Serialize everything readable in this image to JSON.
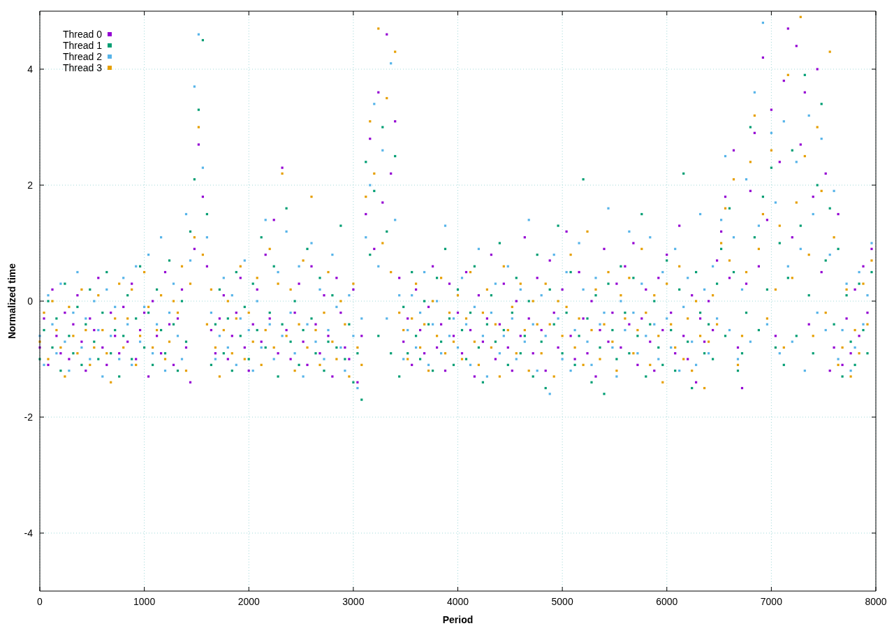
{
  "chart_data": {
    "type": "scatter",
    "xlabel": "Period",
    "ylabel": "Normalized time",
    "xlim": [
      0,
      8000
    ],
    "ylim": [
      -5,
      5
    ],
    "grid": true,
    "legend": true,
    "xticks": [
      {
        "value": 0,
        "label": "0"
      },
      {
        "value": 1000,
        "label": "1000"
      },
      {
        "value": 2000,
        "label": "2000"
      },
      {
        "value": 3000,
        "label": "3000"
      },
      {
        "value": 4000,
        "label": "4000"
      },
      {
        "value": 5000,
        "label": "5000"
      },
      {
        "value": 6000,
        "label": "6000"
      },
      {
        "value": 7000,
        "label": "7000"
      },
      {
        "value": 8000,
        "label": "8000"
      }
    ],
    "yticks": [
      {
        "value": -4,
        "label": "-4"
      },
      {
        "value": -2,
        "label": "-2"
      },
      {
        "value": 0,
        "label": "0"
      },
      {
        "value": 2,
        "label": "2"
      },
      {
        "value": 4,
        "label": "4"
      }
    ],
    "x": [
      0,
      40,
      80,
      120,
      160,
      200,
      240,
      280,
      320,
      360,
      400,
      440,
      480,
      520,
      560,
      600,
      640,
      680,
      720,
      760,
      800,
      840,
      880,
      920,
      960,
      1000,
      1040,
      1080,
      1120,
      1160,
      1200,
      1240,
      1280,
      1320,
      1360,
      1400,
      1440,
      1480,
      1520,
      1560,
      1600,
      1640,
      1680,
      1720,
      1760,
      1800,
      1840,
      1880,
      1920,
      1960,
      2000,
      2040,
      2080,
      2120,
      2160,
      2200,
      2240,
      2280,
      2320,
      2360,
      2400,
      2440,
      2480,
      2520,
      2560,
      2600,
      2640,
      2680,
      2720,
      2760,
      2800,
      2840,
      2880,
      2920,
      2960,
      3000,
      3040,
      3080,
      3120,
      3160,
      3200,
      3240,
      3280,
      3320,
      3360,
      3400,
      3440,
      3480,
      3520,
      3560,
      3600,
      3640,
      3680,
      3720,
      3760,
      3800,
      3840,
      3880,
      3920,
      3960,
      4000,
      4040,
      4080,
      4120,
      4160,
      4200,
      4240,
      4280,
      4320,
      4360,
      4400,
      4440,
      4480,
      4520,
      4560,
      4600,
      4640,
      4680,
      4720,
      4760,
      4800,
      4840,
      4880,
      4920,
      4960,
      5000,
      5040,
      5080,
      5120,
      5160,
      5200,
      5240,
      5280,
      5320,
      5360,
      5400,
      5440,
      5480,
      5520,
      5560,
      5600,
      5640,
      5680,
      5720,
      5760,
      5800,
      5840,
      5880,
      5920,
      5960,
      6000,
      6040,
      6080,
      6120,
      6160,
      6200,
      6240,
      6280,
      6320,
      6360,
      6400,
      6440,
      6480,
      6520,
      6560,
      6600,
      6640,
      6680,
      6720,
      6760,
      6800,
      6840,
      6880,
      6920,
      6960,
      7000,
      7040,
      7080,
      7120,
      7160,
      7200,
      7240,
      7280,
      7320,
      7360,
      7400,
      7440,
      7480,
      7520,
      7560,
      7600,
      7640,
      7680,
      7720,
      7760,
      7800,
      7840,
      7880,
      7920,
      7960
    ],
    "series": [
      {
        "name": "Thread 0",
        "color": "#9400d3",
        "values": [
          -0.8,
          -0.3,
          -1.1,
          0.2,
          -0.6,
          -0.9,
          -0.2,
          -1.0,
          -0.4,
          0.1,
          -0.7,
          -1.2,
          -0.3,
          -0.5,
          0.4,
          -0.8,
          -1.1,
          -0.2,
          -0.6,
          -0.9,
          -0.1,
          -0.7,
          0.3,
          -1.0,
          -0.5,
          -0.2,
          -1.3,
          0.0,
          -0.6,
          -0.9,
          0.5,
          -0.4,
          -1.1,
          -0.3,
          0.2,
          -0.8,
          -1.4,
          0.9,
          2.7,
          1.8,
          0.6,
          -0.5,
          -0.9,
          -0.3,
          0.1,
          -1.0,
          -0.6,
          -0.2,
          0.4,
          -0.8,
          -1.2,
          -0.4,
          0.2,
          -0.7,
          0.8,
          -0.3,
          1.4,
          -0.9,
          2.3,
          -0.5,
          -1.0,
          -0.2,
          0.3,
          -0.7,
          -1.1,
          0.6,
          -0.4,
          -0.9,
          0.1,
          -0.6,
          -1.3,
          0.4,
          -0.2,
          -0.8,
          -1.0,
          0.2,
          -1.4,
          -0.6,
          1.5,
          2.8,
          0.9,
          3.6,
          1.7,
          4.6,
          2.2,
          3.1,
          0.4,
          -0.7,
          -0.3,
          -1.1,
          0.2,
          -0.5,
          -0.9,
          -0.1,
          0.6,
          -0.8,
          -0.4,
          -1.2,
          0.3,
          -0.6,
          -0.2,
          -0.9,
          0.5,
          -0.5,
          -1.3,
          0.1,
          -0.7,
          -0.3,
          0.8,
          -1.0,
          -0.4,
          0.3,
          -0.8,
          -1.2,
          0.0,
          -0.6,
          1.1,
          -0.3,
          -0.9,
          0.4,
          -0.5,
          -1.2,
          0.7,
          -0.2,
          -0.8,
          0.2,
          1.2,
          -0.6,
          -1.0,
          0.5,
          -0.3,
          -0.9,
          0.0,
          -1.3,
          -0.5,
          0.9,
          -0.7,
          -0.2,
          0.3,
          -0.8,
          0.6,
          -0.4,
          1.0,
          -1.1,
          -0.3,
          0.2,
          -0.7,
          -1.2,
          0.4,
          -0.5,
          0.8,
          -0.2,
          -0.9,
          1.3,
          -0.6,
          -1.0,
          0.1,
          -1.4,
          -0.3,
          -0.7,
          0.0,
          -0.5,
          0.7,
          1.2,
          1.8,
          0.4,
          2.6,
          -0.8,
          -1.5,
          0.3,
          1.9,
          2.9,
          0.6,
          4.2,
          1.4,
          3.3,
          -0.6,
          2.4,
          3.8,
          4.7,
          1.1,
          4.4,
          2.7,
          3.6,
          -0.4,
          1.8,
          4.0,
          0.5,
          2.2,
          -1.2,
          -0.8,
          1.5,
          -1.1,
          -0.3,
          -0.9,
          0.2,
          -0.6,
          0.6,
          -0.2,
          0.9
        ]
      },
      {
        "name": "Thread 1",
        "color": "#009e73",
        "values": [
          -1.0,
          -0.5,
          0.0,
          -0.8,
          -0.3,
          -1.2,
          0.3,
          -0.6,
          -0.9,
          -0.1,
          -1.1,
          -0.4,
          0.2,
          -0.7,
          -1.0,
          -0.2,
          0.5,
          -0.9,
          -0.5,
          -1.3,
          -0.6,
          0.1,
          -1.0,
          -0.3,
          0.6,
          -0.8,
          -0.2,
          -1.1,
          0.2,
          -0.5,
          -0.9,
          0.7,
          -0.4,
          -1.2,
          0.0,
          -0.7,
          1.2,
          2.1,
          3.3,
          4.5,
          1.5,
          -1.1,
          -0.4,
          0.2,
          -0.9,
          -0.3,
          -1.2,
          0.5,
          -0.6,
          -0.1,
          -1.0,
          0.3,
          -0.5,
          1.1,
          -0.8,
          -0.2,
          0.6,
          -1.3,
          -0.4,
          1.6,
          -0.7,
          0.0,
          -1.1,
          -0.5,
          0.9,
          -0.3,
          -0.9,
          0.4,
          -1.2,
          -0.7,
          0.1,
          -0.8,
          1.3,
          -1.0,
          -0.4,
          -1.4,
          -0.9,
          -1.7,
          2.4,
          0.8,
          1.9,
          -0.6,
          3.0,
          1.2,
          -0.9,
          2.5,
          -1.3,
          -0.1,
          -0.9,
          0.5,
          -0.6,
          -1.0,
          0.0,
          -0.4,
          -1.2,
          0.4,
          -0.7,
          0.9,
          -0.3,
          -1.1,
          0.2,
          -0.5,
          -1.0,
          -0.2,
          0.6,
          -0.8,
          -1.4,
          -0.4,
          0.1,
          -0.7,
          1.0,
          -0.5,
          -1.1,
          -0.2,
          0.4,
          -0.9,
          -0.6,
          0.0,
          -1.3,
          0.8,
          -0.7,
          -1.5,
          0.2,
          -0.4,
          1.3,
          -0.9,
          -0.2,
          0.5,
          -1.1,
          -0.6,
          2.1,
          -0.3,
          -1.4,
          0.1,
          -0.8,
          -1.6,
          0.3,
          -0.5,
          -1.0,
          0.6,
          -0.2,
          -0.9,
          0.4,
          -0.6,
          1.5,
          -1.3,
          -0.4,
          0.0,
          -0.8,
          -1.1,
          0.7,
          -0.5,
          -1.2,
          0.2,
          2.2,
          -0.7,
          -1.5,
          0.5,
          -0.2,
          -0.9,
          -0.4,
          -1.0,
          0.3,
          0.9,
          -0.6,
          1.6,
          0.5,
          -1.2,
          -0.9,
          -0.2,
          3.0,
          1.1,
          -0.5,
          1.8,
          0.2,
          2.3,
          -0.8,
          1.0,
          -1.1,
          0.4,
          2.6,
          -0.6,
          1.3,
          3.9,
          0.1,
          -0.9,
          2.0,
          3.4,
          0.7,
          1.6,
          -0.4,
          0.9,
          -1.3,
          0.1,
          -0.7,
          -1.1,
          0.3,
          -0.5,
          -0.9,
          0.5
        ]
      },
      {
        "name": "Thread 2",
        "color": "#56b4e9",
        "values": [
          -0.6,
          -1.1,
          0.1,
          -0.4,
          -0.9,
          0.3,
          -0.7,
          -1.2,
          -0.2,
          0.5,
          -0.8,
          -0.3,
          -1.0,
          0.0,
          -0.5,
          -1.3,
          0.2,
          -0.6,
          -0.1,
          -1.0,
          0.4,
          -0.4,
          -1.1,
          0.6,
          -0.7,
          -0.1,
          0.8,
          -0.9,
          -0.4,
          1.1,
          -1.2,
          -0.2,
          0.3,
          -0.6,
          -1.0,
          1.5,
          0.7,
          3.7,
          4.6,
          2.3,
          1.1,
          -0.2,
          -1.0,
          -0.6,
          0.4,
          -0.8,
          0.1,
          -1.1,
          -0.3,
          0.7,
          -0.5,
          -1.2,
          0.0,
          -0.8,
          1.4,
          -0.4,
          -1.0,
          0.5,
          -0.6,
          1.2,
          -0.2,
          -0.9,
          0.6,
          -1.3,
          -0.4,
          1.0,
          -0.7,
          0.2,
          -1.0,
          -0.5,
          0.8,
          -0.1,
          -0.8,
          -1.2,
          0.1,
          -0.6,
          -1.5,
          -0.3,
          1.1,
          2.0,
          3.4,
          0.6,
          2.6,
          -0.3,
          4.1,
          1.4,
          0.1,
          -1.0,
          -0.5,
          0.1,
          -0.8,
          -0.2,
          0.5,
          -1.1,
          -0.4,
          0.0,
          -0.9,
          1.3,
          -0.6,
          -0.3,
          -0.8,
          0.4,
          -0.4,
          -1.1,
          -0.1,
          0.9,
          -0.6,
          -1.3,
          -0.2,
          0.3,
          -0.9,
          -0.6,
          0.6,
          -0.3,
          -1.0,
          0.2,
          -0.7,
          1.4,
          -0.4,
          -1.2,
          0.1,
          -0.6,
          -1.6,
          0.8,
          -0.3,
          -1.0,
          0.5,
          -1.2,
          -0.5,
          1.0,
          0.2,
          -0.7,
          -1.1,
          0.4,
          -0.4,
          -0.2,
          1.6,
          -0.8,
          -1.3,
          0.0,
          -0.5,
          1.2,
          -0.2,
          -0.9,
          0.3,
          -0.6,
          1.1,
          -0.4,
          -1.0,
          0.5,
          -0.3,
          -0.8,
          0.9,
          -1.2,
          -0.1,
          0.4,
          -0.7,
          -1.1,
          1.5,
          0.2,
          -0.9,
          0.6,
          -0.3,
          1.4,
          2.5,
          -0.5,
          1.1,
          -1.0,
          0.2,
          2.1,
          -0.7,
          3.6,
          1.3,
          4.8,
          -0.4,
          2.9,
          1.7,
          -0.9,
          3.1,
          0.6,
          -0.7,
          2.4,
          0.9,
          -1.2,
          3.2,
          1.5,
          -0.2,
          2.8,
          -0.5,
          0.8,
          1.9,
          -1.0,
          -0.5,
          0.3,
          -1.2,
          -0.8,
          0.5,
          -0.4,
          0.1,
          1.0
        ]
      },
      {
        "name": "Thread 3",
        "color": "#e69f00",
        "values": [
          -0.7,
          -0.2,
          -1.0,
          0.0,
          -0.5,
          -0.8,
          -1.3,
          -0.1,
          -0.6,
          -0.9,
          0.2,
          -0.5,
          -1.1,
          -0.8,
          0.1,
          -0.5,
          -0.9,
          -1.4,
          -0.3,
          0.3,
          -0.8,
          -0.3,
          0.2,
          -1.1,
          -0.6,
          0.5,
          -0.1,
          -0.8,
          -0.5,
          0.1,
          -1.0,
          -0.7,
          0.0,
          -0.2,
          0.6,
          -1.2,
          0.3,
          1.1,
          3.0,
          0.8,
          -0.4,
          0.2,
          -0.8,
          -1.3,
          -0.5,
          0.0,
          -0.9,
          -0.3,
          0.6,
          -1.0,
          -0.2,
          -0.7,
          0.4,
          -1.1,
          -0.5,
          0.9,
          -0.8,
          0.3,
          2.2,
          -0.6,
          0.2,
          -1.2,
          -0.4,
          0.7,
          -0.8,
          1.8,
          -0.5,
          -1.1,
          -0.2,
          0.5,
          -0.7,
          -1.0,
          0.0,
          -0.4,
          -1.3,
          0.3,
          -0.8,
          -1.1,
          1.8,
          3.1,
          2.2,
          4.7,
          1.0,
          3.5,
          0.5,
          4.3,
          -0.2,
          -0.5,
          -1.0,
          -0.3,
          0.3,
          -0.8,
          -0.4,
          -1.2,
          0.0,
          -0.6,
          0.4,
          -0.9,
          -0.2,
          -0.7,
          0.1,
          -1.0,
          -0.3,
          0.5,
          -0.7,
          -1.1,
          -0.2,
          0.2,
          -0.8,
          -0.4,
          -1.3,
          0.6,
          -0.5,
          -0.1,
          -0.9,
          0.3,
          -0.5,
          -1.2,
          0.0,
          -0.4,
          -0.9,
          0.3,
          -0.4,
          -1.3,
          0.0,
          -0.6,
          -0.1,
          0.8,
          -0.8,
          -0.3,
          -1.1,
          1.2,
          -0.5,
          0.2,
          -1.0,
          -0.4,
          0.5,
          -0.7,
          -1.2,
          0.1,
          -0.3,
          0.4,
          -0.9,
          -0.5,
          0.9,
          -0.2,
          -1.1,
          0.1,
          -0.6,
          -1.4,
          0.3,
          -0.4,
          -0.8,
          0.6,
          -1.0,
          -0.3,
          -1.2,
          0.0,
          -0.6,
          -1.5,
          -0.7,
          0.1,
          -0.4,
          1.0,
          1.6,
          0.7,
          2.1,
          -1.1,
          -0.6,
          0.5,
          2.4,
          3.2,
          0.9,
          1.5,
          -0.3,
          2.6,
          0.2,
          1.3,
          -0.8,
          3.9,
          0.4,
          1.7,
          4.9,
          2.5,
          0.8,
          -0.6,
          3.0,
          1.9,
          -0.2,
          4.3,
          1.1,
          -1.1,
          -0.8,
          0.2,
          -1.3,
          -0.5,
          -0.9,
          0.3,
          -0.4,
          0.7
        ]
      }
    ]
  }
}
